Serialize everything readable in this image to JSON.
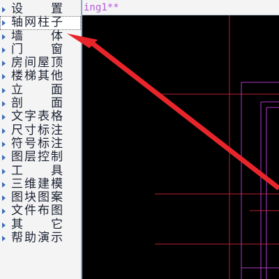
{
  "menu": {
    "items": [
      {
        "label": "设　置"
      },
      {
        "label": "轴网柱子"
      },
      {
        "label": "墙　体"
      },
      {
        "label": "门　窗"
      },
      {
        "label": "房间屋顶"
      },
      {
        "label": "楼梯其他"
      },
      {
        "label": "立　面"
      },
      {
        "label": "剖　面"
      },
      {
        "label": "文字表格"
      },
      {
        "label": "尺寸标注"
      },
      {
        "label": "符号标注"
      },
      {
        "label": "图层控制"
      },
      {
        "label": "工　具"
      },
      {
        "label": "三维建模"
      },
      {
        "label": "图块图案"
      },
      {
        "label": "文件布图"
      },
      {
        "label": "其　它"
      },
      {
        "label": "帮助演示"
      }
    ],
    "active_index": 1
  },
  "document": {
    "tab_title": "ing1**"
  },
  "colors": {
    "canvas_background": "#000000",
    "axis_line": "#c0202e",
    "wall_line": "#b03cc8",
    "annotation_arrow": "#e8252b",
    "menu_arrow": "#3d6db5"
  },
  "icons": {
    "menu_item_marker": "triangle-right-icon",
    "annotation": "arrow-pointer-icon"
  }
}
